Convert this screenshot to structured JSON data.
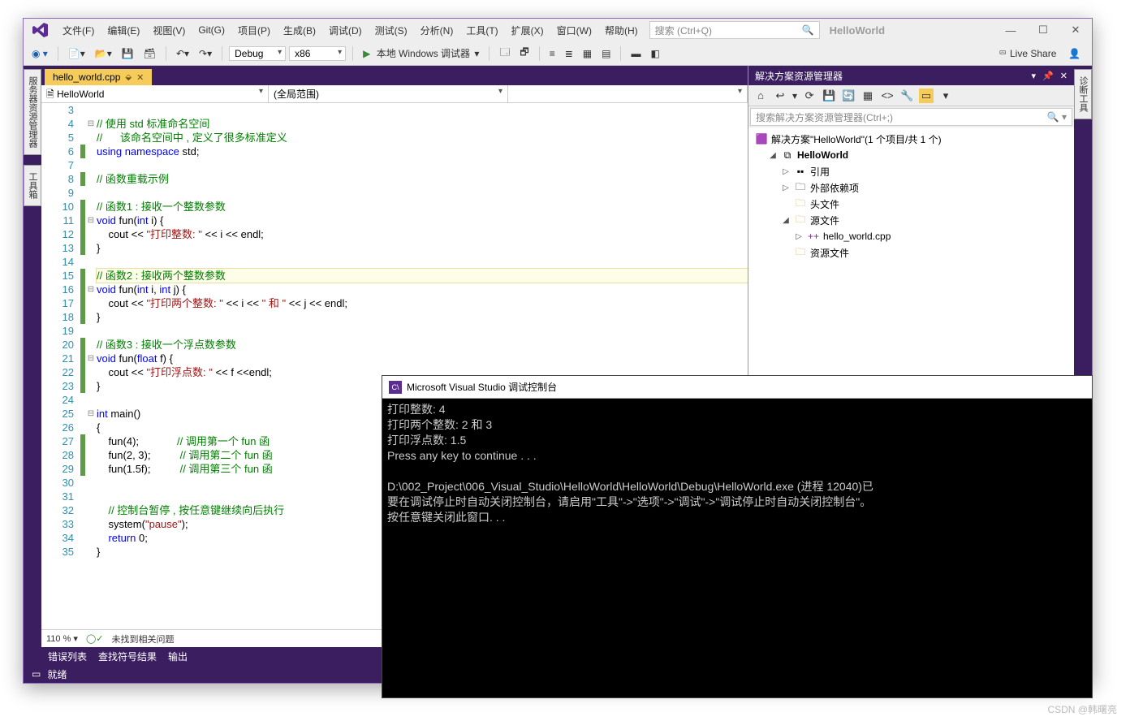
{
  "title_sol": "HelloWorld",
  "menus": [
    "文件(F)",
    "编辑(E)",
    "视图(V)",
    "Git(G)",
    "项目(P)",
    "生成(B)",
    "调试(D)",
    "测试(S)",
    "分析(N)",
    "工具(T)",
    "扩展(X)",
    "窗口(W)",
    "帮助(H)"
  ],
  "search_ph": "搜索 (Ctrl+Q)",
  "config": "Debug",
  "platform": "x86",
  "run_label": "本地 Windows 调试器",
  "liveshare": "Live Share",
  "rails_left": [
    "服务器资源管理器",
    "工具箱"
  ],
  "rails_right": [
    "诊断工具"
  ],
  "doc_tab": "hello_world.cpp",
  "nav1": "HelloWorld",
  "nav2": "(全局范围)",
  "nav3": "",
  "lines_start": 3,
  "zoom": "110 %",
  "issues": "未找到相关问题",
  "output_tabs": [
    "错误列表",
    "查找符号结果",
    "输出"
  ],
  "status": "就绪",
  "sln_title": "解决方案资源管理器",
  "sln_search_ph": "搜索解决方案资源管理器(Ctrl+;)",
  "sln_root": "解决方案\"HelloWorld\"(1 个项目/共 1 个)",
  "sln_proj": "HelloWorld",
  "sln_items": {
    "ref": "引用",
    "ext": "外部依赖项",
    "hdr": "头文件",
    "src": "源文件",
    "file": "hello_world.cpp",
    "res": "资源文件"
  },
  "code": [
    {
      "n": 3,
      "t": ""
    },
    {
      "n": 4,
      "fold": "⊟",
      "html": "<span class='tok-comment'>// 使用 std 标准命名空间</span>"
    },
    {
      "n": 5,
      "html": "<span class='tok-comment'>//      该命名空间中 , 定义了很多标准定义</span>"
    },
    {
      "n": 6,
      "mark": "g",
      "html": "<span class='tok-keyword'>using</span> <span class='tok-keyword'>namespace</span> std;"
    },
    {
      "n": 7,
      "t": ""
    },
    {
      "n": 8,
      "mark": "g",
      "html": "<span class='tok-comment'>// 函数重载示例</span>"
    },
    {
      "n": 9,
      "t": ""
    },
    {
      "n": 10,
      "mark": "g",
      "html": "<span class='tok-comment'>// 函数1 : 接收一个整数参数</span>"
    },
    {
      "n": 11,
      "mark": "g",
      "fold": "⊟",
      "html": "<span class='tok-keyword'>void</span> fun(<span class='tok-keyword'>int</span> i) {"
    },
    {
      "n": 12,
      "mark": "g",
      "html": "    cout &lt;&lt; <span class='tok-string'>\"打印整数: \"</span> &lt;&lt; i &lt;&lt; endl;"
    },
    {
      "n": 13,
      "mark": "g",
      "html": "}"
    },
    {
      "n": 14,
      "t": ""
    },
    {
      "n": 15,
      "mark": "g",
      "hl": true,
      "html": "<span class='tok-comment'>// 函数2 : 接收两个整数参数</span>"
    },
    {
      "n": 16,
      "mark": "g",
      "fold": "⊟",
      "html": "<span class='tok-keyword'>void</span> fun(<span class='tok-keyword'>int</span> i, <span class='tok-keyword'>int</span> j) {"
    },
    {
      "n": 17,
      "mark": "g",
      "html": "    cout &lt;&lt; <span class='tok-string'>\"打印两个整数: \"</span> &lt;&lt; i &lt;&lt; <span class='tok-string'>\" 和 \"</span> &lt;&lt; j &lt;&lt; endl;"
    },
    {
      "n": 18,
      "mark": "g",
      "html": "}"
    },
    {
      "n": 19,
      "t": ""
    },
    {
      "n": 20,
      "mark": "g",
      "html": "<span class='tok-comment'>// 函数3 : 接收一个浮点数参数</span>"
    },
    {
      "n": 21,
      "mark": "g",
      "fold": "⊟",
      "html": "<span class='tok-keyword'>void</span> fun(<span class='tok-keyword'>float</span> f) {"
    },
    {
      "n": 22,
      "mark": "g",
      "html": "    cout &lt;&lt; <span class='tok-string'>\"打印浮点数: \"</span> &lt;&lt; f &lt;&lt;endl;"
    },
    {
      "n": 23,
      "mark": "g",
      "html": "}"
    },
    {
      "n": 24,
      "t": ""
    },
    {
      "n": 25,
      "fold": "⊟",
      "html": "<span class='tok-keyword'>int</span> main()"
    },
    {
      "n": 26,
      "html": "{"
    },
    {
      "n": 27,
      "mark": "g",
      "html": "    fun(4);             <span class='tok-comment'>// 调用第一个 fun 函</span>"
    },
    {
      "n": 28,
      "mark": "g",
      "html": "    fun(2, 3);          <span class='tok-comment'>// 调用第二个 fun 函</span>"
    },
    {
      "n": 29,
      "mark": "g",
      "html": "    fun(1.5f);          <span class='tok-comment'>// 调用第三个 fun 函</span>"
    },
    {
      "n": 30,
      "t": ""
    },
    {
      "n": 31,
      "t": ""
    },
    {
      "n": 32,
      "html": "    <span class='tok-comment'>// 控制台暂停 , 按任意键继续向后执行</span>"
    },
    {
      "n": 33,
      "html": "    system(<span class='tok-string'>\"pause\"</span>);"
    },
    {
      "n": 34,
      "html": "    <span class='tok-keyword'>return</span> 0;"
    },
    {
      "n": 35,
      "html": "}"
    }
  ],
  "console_title": "Microsoft Visual Studio 调试控制台",
  "console_lines": [
    "打印整数: 4",
    "打印两个整数: 2 和 3",
    "打印浮点数: 1.5",
    "Press any key to continue . . .",
    "",
    "D:\\002_Project\\006_Visual_Studio\\HelloWorld\\HelloWorld\\Debug\\HelloWorld.exe (进程 12040)已",
    "要在调试停止时自动关闭控制台，请启用\"工具\"->\"选项\"->\"调试\"->\"调试停止时自动关闭控制台\"。",
    "按任意键关闭此窗口. . ."
  ],
  "watermark": "CSDN @韩曙亮"
}
